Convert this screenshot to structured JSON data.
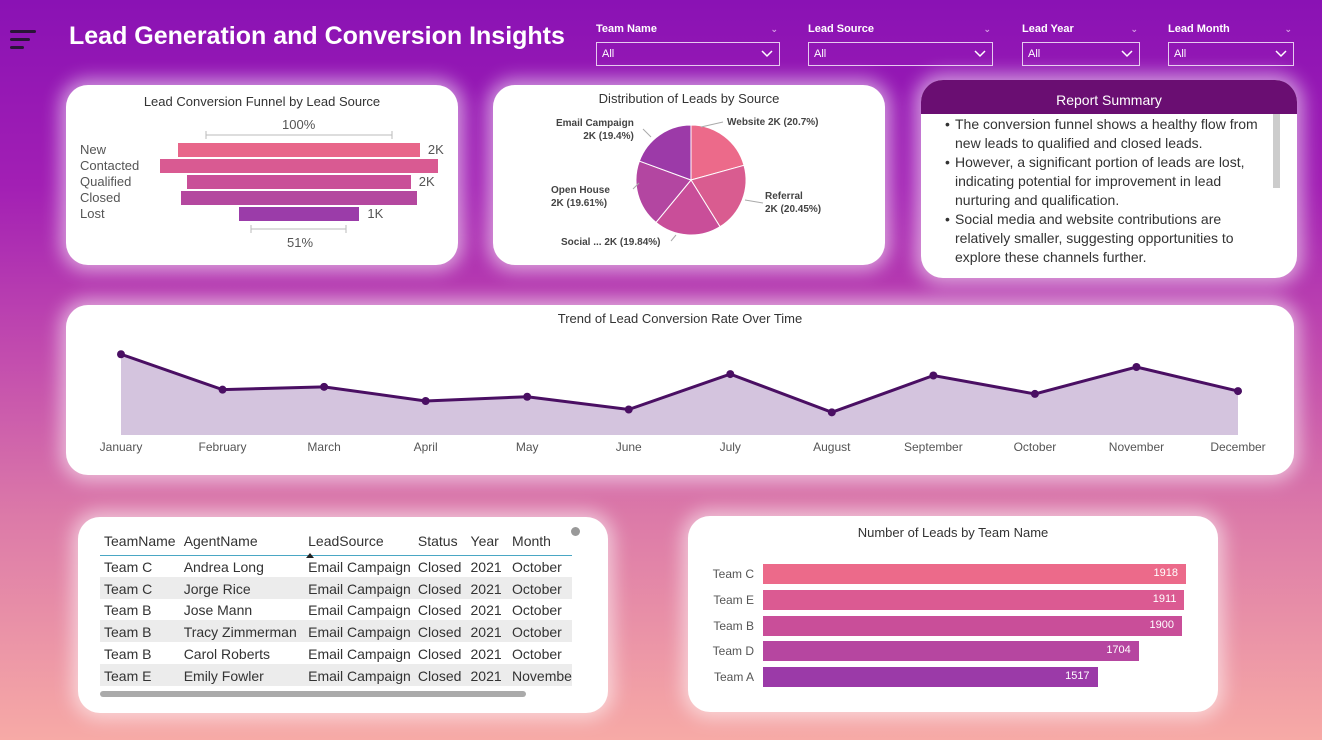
{
  "header": {
    "title": "Lead Generation and Conversion Insights",
    "menu_icon": "hamburger-menu-icon"
  },
  "filters": [
    {
      "label": "Team Name",
      "value": "All"
    },
    {
      "label": "Lead Source",
      "value": "All"
    },
    {
      "label": "Lead Year",
      "value": "All"
    },
    {
      "label": "Lead Month",
      "value": "All"
    }
  ],
  "funnel": {
    "title": "Lead Conversion Funnel by Lead Source",
    "top_pct": "100%",
    "bottom_pct": "51%",
    "stages": [
      {
        "label": "New",
        "value_label": "2K",
        "value": 2000,
        "color": "#e8668a"
      },
      {
        "label": "Contacted",
        "value_label": "",
        "value": 2300,
        "color": "#d95a92"
      },
      {
        "label": "Qualified",
        "value_label": "2K",
        "value": 1850,
        "color": "#c94f98"
      },
      {
        "label": "Closed",
        "value_label": "",
        "value": 1950,
        "color": "#b4489f"
      },
      {
        "label": "Lost",
        "value_label": "1K",
        "value": 1000,
        "color": "#9b3ca9"
      }
    ]
  },
  "pie": {
    "title": "Distribution of Leads by Source",
    "slices": [
      {
        "name": "Website",
        "label": "Website 2K (20.7%)",
        "pct": 20.7,
        "color": "#ec6a8a"
      },
      {
        "name": "Referral",
        "label_line1": "Referral",
        "label_line2": "2K (20.45%)",
        "pct": 20.45,
        "color": "#d95c90"
      },
      {
        "name": "Social Media",
        "label": "Social ... 2K (19.84%)",
        "pct": 19.84,
        "color": "#c94e99"
      },
      {
        "name": "Open House",
        "label_line1": "Open House",
        "label_line2": "2K (19.61%)",
        "pct": 19.61,
        "color": "#b346a1"
      },
      {
        "name": "Email Campaign",
        "label_line1": "Email Campaign",
        "label_line2": "2K (19.4%)",
        "pct": 19.4,
        "color": "#9c3aa8"
      }
    ]
  },
  "summary": {
    "title": "Report Summary",
    "points": [
      "The conversion funnel shows a healthy flow from new leads to qualified and closed leads.",
      "However, a significant portion of leads are lost, indicating potential for improvement in lead nurturing and qualification.",
      "Social media and website contributions are relatively smaller, suggesting opportunities to explore these channels further."
    ]
  },
  "chart_data": [
    {
      "type": "area",
      "title": "Trend of Lead Conversion Rate Over Time",
      "categories": [
        "January",
        "February",
        "March",
        "April",
        "May",
        "June",
        "July",
        "August",
        "September",
        "October",
        "November",
        "December"
      ],
      "values": [
        57,
        32,
        34,
        24,
        27,
        18,
        43,
        16,
        42,
        29,
        48,
        31
      ],
      "ylim": [
        0,
        60
      ],
      "line_color": "#4a0f63",
      "fill_color": "#d4c4de"
    },
    {
      "type": "bar",
      "orientation": "horizontal",
      "title": "Number of Leads by Team Name",
      "categories": [
        "Team C",
        "Team E",
        "Team B",
        "Team D",
        "Team A"
      ],
      "values": [
        1918,
        1911,
        1900,
        1704,
        1517
      ],
      "colors": [
        "#ec6a8a",
        "#db5a92",
        "#c94e99",
        "#b646a0",
        "#9b3aa8"
      ],
      "xlim": [
        0,
        1918
      ]
    }
  ],
  "table": {
    "columns": [
      "TeamName",
      "AgentName",
      "LeadSource",
      "Status",
      "Year",
      "Month"
    ],
    "rows": [
      [
        "Team C",
        "Andrea Long",
        "Email Campaign",
        "Closed",
        "2021",
        "October"
      ],
      [
        "Team C",
        "Jorge Rice",
        "Email Campaign",
        "Closed",
        "2021",
        "October"
      ],
      [
        "Team B",
        "Jose Mann",
        "Email Campaign",
        "Closed",
        "2021",
        "October"
      ],
      [
        "Team B",
        "Tracy Zimmerman",
        "Email Campaign",
        "Closed",
        "2021",
        "October"
      ],
      [
        "Team B",
        "Carol Roberts",
        "Email Campaign",
        "Closed",
        "2021",
        "October"
      ],
      [
        "Team E",
        "Emily Fowler",
        "Email Campaign",
        "Closed",
        "2021",
        "Novembe"
      ]
    ]
  }
}
